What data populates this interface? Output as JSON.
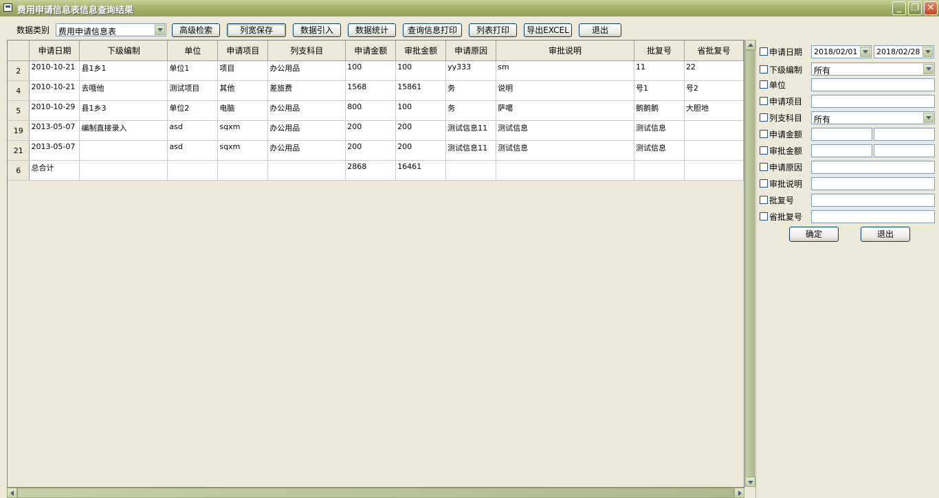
{
  "window": {
    "title": "费用申请信息表信息查询结果"
  },
  "toolbar": {
    "data_type_label": "数据类别",
    "data_type_value": "费用申请信息表",
    "buttons": [
      "高级检索",
      "列宽保存",
      "数据引入",
      "数据统计",
      "查询信息打印",
      "列表打印",
      "导出EXCEL",
      "退出"
    ]
  },
  "table": {
    "columns": [
      "申请日期",
      "下级编制",
      "单位",
      "申请项目",
      "列支科目",
      "申请金额",
      "审批金额",
      "申请原因",
      "审批说明",
      "批复号",
      "省批复号"
    ],
    "rows": [
      {
        "num": "2",
        "cells": [
          "2010-10-21",
          "县1乡1",
          "单位1",
          "项目",
          "办公用品",
          "100",
          "100",
          "yy333",
          "sm",
          "11",
          "22"
        ]
      },
      {
        "num": "4",
        "cells": [
          "2010-10-21",
          "去哦他",
          "测试项目",
          "其他",
          "差旅费",
          "1568",
          "15861",
          "务",
          "说明",
          "号1",
          "号2"
        ]
      },
      {
        "num": "5",
        "cells": [
          "2010-10-29",
          "县1乡3",
          "单位2",
          "电脑",
          "办公用品",
          "800",
          "100",
          "务",
          "萨噶",
          "鹅鹅鹅",
          "大胆地"
        ]
      },
      {
        "num": "19",
        "cells": [
          "2013-05-07",
          "编制直接录入",
          "asd",
          "sqxm",
          "办公用品",
          "200",
          "200",
          "测试信息11",
          "测试信息",
          "测试信息",
          ""
        ]
      },
      {
        "num": "21",
        "cells": [
          "2013-05-07",
          "",
          "asd",
          "sqxm",
          "办公用品",
          "200",
          "200",
          "测试信息11",
          "测试信息",
          "测试信息",
          ""
        ]
      },
      {
        "num": "6",
        "cells": [
          "总合计",
          "",
          "",
          "",
          "",
          "2868",
          "16461",
          "",
          "",
          "",
          ""
        ]
      }
    ]
  },
  "filter": {
    "fields": [
      {
        "label": "申请日期",
        "type": "daterange",
        "from": "2018/02/01",
        "to": "2018/02/28"
      },
      {
        "label": "下级编制",
        "type": "select",
        "value": "所有"
      },
      {
        "label": "单位",
        "type": "text"
      },
      {
        "label": "申请项目",
        "type": "text"
      },
      {
        "label": "列支科目",
        "type": "select",
        "value": "所有"
      },
      {
        "label": "申请金额",
        "type": "range"
      },
      {
        "label": "审批金额",
        "type": "range"
      },
      {
        "label": "申请原因",
        "type": "text"
      },
      {
        "label": "审批说明",
        "type": "text"
      },
      {
        "label": "批复号",
        "type": "text"
      },
      {
        "label": "省批复号",
        "type": "text"
      }
    ],
    "ok_label": "确定",
    "exit_label": "退出"
  },
  "colors": {
    "titlebar": "#A7B26A",
    "window_bg": "#ECE9D8",
    "button_border": "#003C74"
  }
}
